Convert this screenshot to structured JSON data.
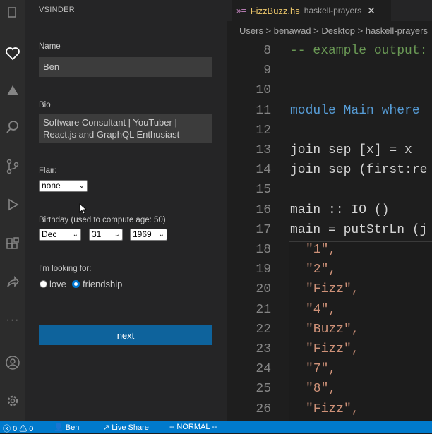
{
  "sidebar": {
    "title": "VSINDER",
    "name_label": "Name",
    "name_value": "Ben",
    "bio_label": "Bio",
    "bio_value": "Software Consultant | YouTuber | React.js and GraphQL Enthusiast",
    "flair_label": "Flair:",
    "flair_value": "none",
    "birthday_label": "Birthday (used to compute age: 50)",
    "birthday_month": "Dec",
    "birthday_day": "31",
    "birthday_year": "1969",
    "looking_label": "I'm looking for:",
    "option_love": "love",
    "option_friendship": "friendship",
    "next_label": "next"
  },
  "editor": {
    "tab_name": "FizzBuzz.hs",
    "tab_desc": "haskell-prayers",
    "breadcrumb": "Users > benawad > Desktop > haskell-prayers",
    "lines": [
      {
        "n": "8",
        "code": "-- example output:",
        "color": "#6a9955"
      },
      {
        "n": "9",
        "code": "",
        "color": "#d4d4d4"
      },
      {
        "n": "10",
        "code": "",
        "color": "#d4d4d4"
      },
      {
        "n": "11",
        "code": "module Main where",
        "color": "#569cd6"
      },
      {
        "n": "12",
        "code": "",
        "color": "#d4d4d4"
      },
      {
        "n": "13",
        "code": "join sep [x] = x",
        "color": "#d4d4d4"
      },
      {
        "n": "14",
        "code": "join sep (first:re",
        "color": "#d4d4d4"
      },
      {
        "n": "15",
        "code": "",
        "color": "#d4d4d4"
      },
      {
        "n": "16",
        "code": "main :: IO ()",
        "color": "#d4d4d4"
      },
      {
        "n": "17",
        "code": "main = putStrLn (j",
        "color": "#d4d4d4"
      },
      {
        "n": "18",
        "code": "\"1\",",
        "color": "#ce9178"
      },
      {
        "n": "19",
        "code": "\"2\",",
        "color": "#ce9178"
      },
      {
        "n": "20",
        "code": "\"Fizz\",",
        "color": "#ce9178"
      },
      {
        "n": "21",
        "code": "\"4\",",
        "color": "#ce9178"
      },
      {
        "n": "22",
        "code": "\"Buzz\",",
        "color": "#ce9178"
      },
      {
        "n": "23",
        "code": "\"Fizz\",",
        "color": "#ce9178"
      },
      {
        "n": "24",
        "code": "\"7\",",
        "color": "#ce9178"
      },
      {
        "n": "25",
        "code": "\"8\",",
        "color": "#ce9178"
      },
      {
        "n": "26",
        "code": "\"Fizz\",",
        "color": "#ce9178"
      }
    ]
  },
  "statusbar": {
    "problems": "0 ⚠ 0",
    "user": "Ben",
    "live_share": "Live Share",
    "mode": "-- NORMAL --"
  },
  "colors": {
    "accent": "#007acc",
    "button": "#0e639c"
  }
}
